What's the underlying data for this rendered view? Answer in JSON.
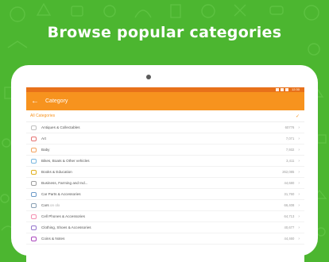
{
  "headline": "Browse popular categories",
  "statusbar": {
    "time": "12:30"
  },
  "appbar": {
    "title": "Category",
    "back_icon": "arrow-left-icon"
  },
  "all_categories": {
    "label": "All Categories",
    "icon": "check-icon"
  },
  "categories": [
    {
      "label": "Antiques & Collectables",
      "count": "60776",
      "icon": "vase-icon",
      "color": "#c0c0c0"
    },
    {
      "label": "Art",
      "count": "7,071",
      "icon": "palette-icon",
      "color": "#e57373"
    },
    {
      "label": "Baby",
      "count": "7,932",
      "icon": "bottle-icon",
      "color": "#f4a460"
    },
    {
      "label": "Bikes, Boats & Other vehicles",
      "count": "3,411",
      "icon": "bike-icon",
      "color": "#7ab8e0"
    },
    {
      "label": "Books & Education",
      "count": "262,085",
      "icon": "book-icon",
      "color": "#e0b020"
    },
    {
      "label": "Business, Farming and Ind...",
      "count": "44,680",
      "icon": "anchor-icon",
      "color": "#9e9e9e"
    },
    {
      "label": "Car Parts & Accessories",
      "count": "31,760",
      "icon": "car-part-icon",
      "color": "#6c9ac8"
    },
    {
      "label": "Cars",
      "sub": "on olx",
      "count": "66,408",
      "icon": "car-icon",
      "color": "#8aa0b4"
    },
    {
      "label": "Cell Phones & Accessories",
      "count": "64,713",
      "icon": "phone-icon",
      "color": "#f48fb1"
    },
    {
      "label": "Clothing, Shoes & Accessories",
      "count": "40,677",
      "icon": "shirt-icon",
      "color": "#9575cd"
    },
    {
      "label": "Coins & Notes",
      "count": "44,460",
      "icon": "coins-icon",
      "color": "#ab47bc"
    }
  ]
}
